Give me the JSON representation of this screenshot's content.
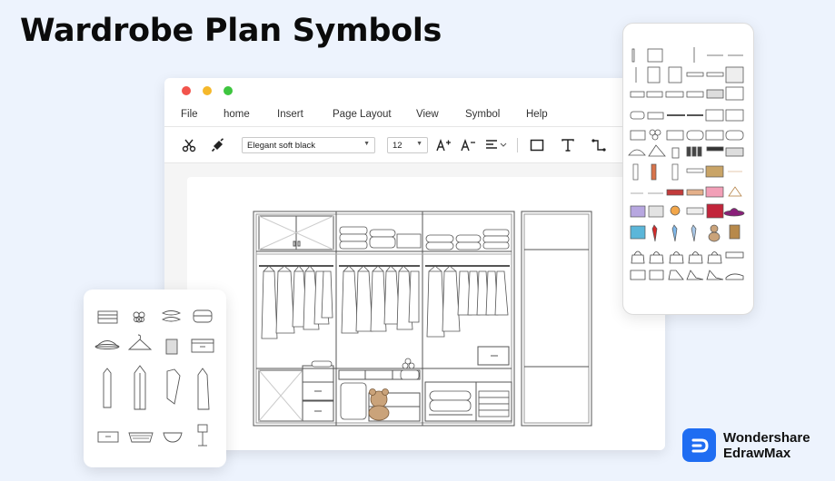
{
  "page": {
    "title": "Wardrobe Plan Symbols"
  },
  "window": {
    "traffic_lights": {
      "close": "#f2544c",
      "minimize": "#f5b82b",
      "maximize": "#3ec53f"
    },
    "menu": [
      "File",
      "home",
      "Insert",
      "Page Layout",
      "View",
      "Symbol",
      "Help"
    ],
    "toolbar": {
      "font_family": "Elegant soft black",
      "font_size": "12",
      "icons": [
        "scissors-icon",
        "format-painter-icon",
        "increase-font-icon",
        "decrease-font-icon",
        "align-icon",
        "rectangle-icon",
        "text-icon",
        "connector-icon"
      ]
    }
  },
  "brand": {
    "line1": "Wondershare",
    "line2": "EdrawMax",
    "color": "#1f6df2"
  }
}
